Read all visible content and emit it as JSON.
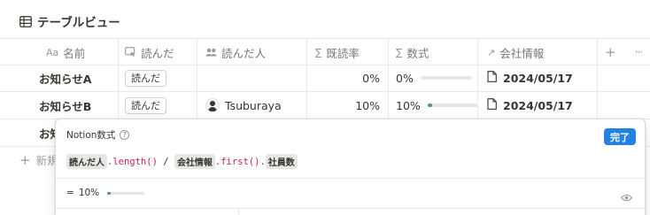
{
  "view": {
    "title": "テーブルビュー",
    "icon": "table-icon"
  },
  "columns": [
    {
      "label": "名前",
      "icon_text": "Aa"
    },
    {
      "label": "読んだ",
      "icon": "button-click-icon"
    },
    {
      "label": "読んだ人",
      "icon": "people-icon"
    },
    {
      "label": "既読率",
      "icon_text": "∑"
    },
    {
      "label": "数式",
      "icon_text": "∑"
    },
    {
      "label": "会社情報",
      "icon_text": "↗"
    }
  ],
  "add_column": "+",
  "more_menu": "···",
  "rows": [
    {
      "name": "お知らせA",
      "read_button": "読んだ",
      "reader": "",
      "rate": "0%",
      "formula": "0%",
      "formula_progress": 0,
      "date": "2024/05/17"
    },
    {
      "name": "お知らせB",
      "read_button": "読んだ",
      "reader": "Tsuburaya",
      "rate": "10%",
      "formula": "10%",
      "formula_progress": 0.1,
      "date": "2024/05/17"
    },
    {
      "name": "お知"
    }
  ],
  "new_row_label": "新規",
  "popup": {
    "title": "Notion数式",
    "help": "?",
    "done": "完了",
    "formula": {
      "token1": "読んだ人",
      "part1": ".length()",
      "part2": " / ",
      "token2": "会社情報",
      "part3": ".first().",
      "token3": "社員数"
    },
    "result_prefix": "=",
    "result_value": "10%",
    "result_progress": 0.1
  },
  "colors": {
    "accent": "#2383e2",
    "progress": "#4d9f64",
    "function": "#c7254e"
  }
}
